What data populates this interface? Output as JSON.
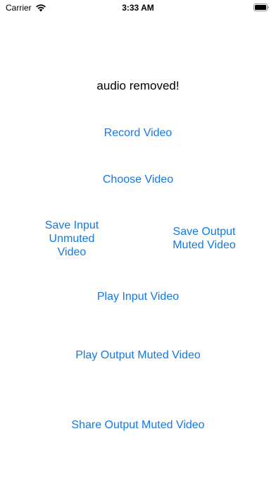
{
  "status_bar": {
    "carrier": "Carrier",
    "time": "3:33 AM",
    "wifi_icon": "wifi-icon",
    "battery_icon": "battery-icon"
  },
  "main": {
    "status_text": "audio removed!",
    "record_video": "Record Video",
    "choose_video": "Choose Video",
    "save_input": "Save Input\nUnmuted\nVideo",
    "save_output": "Save Output\nMuted Video",
    "play_input": "Play Input Video",
    "play_output": "Play Output Muted Video",
    "share_output": "Share Output Muted Video"
  },
  "colors": {
    "accent": "#1479e3",
    "text": "#000000",
    "background": "#ffffff"
  }
}
